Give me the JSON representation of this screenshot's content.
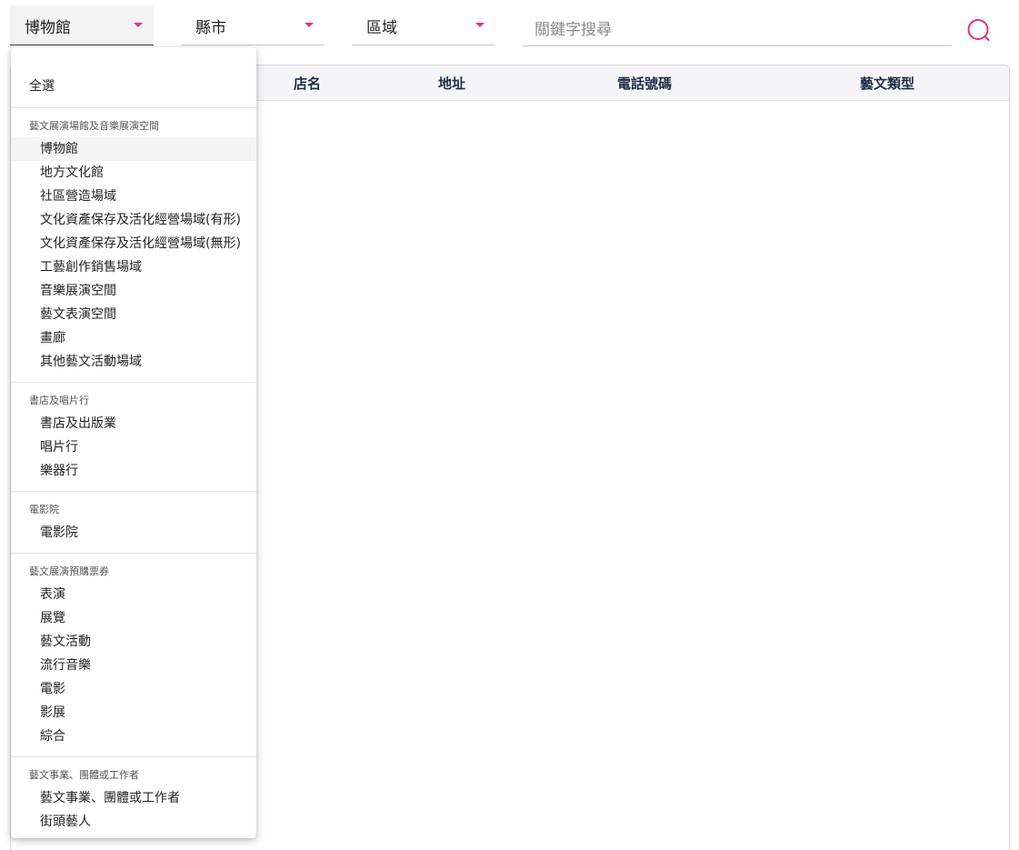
{
  "filters": {
    "category": {
      "value": "博物館"
    },
    "city": {
      "value": "縣市"
    },
    "area": {
      "value": "區域"
    },
    "keyword": {
      "placeholder": "關鍵字搜尋",
      "value": ""
    }
  },
  "colors": {
    "accent": "#e4327d",
    "header_text": "#1f2d4a"
  },
  "search_button": {
    "icon": "search-icon"
  },
  "table": {
    "columns": [
      "店名",
      "地址",
      "電話號碼",
      "藝文類型"
    ],
    "rows": []
  },
  "menu": {
    "all_label": "全選",
    "selected": "博物館",
    "groups": [
      {
        "title": "藝文展演場館及音樂展演空間",
        "items": [
          "博物館",
          "地方文化館",
          "社區營造場域",
          "文化資產保存及活化經營場域(有形)",
          "文化資產保存及活化經營場域(無形)",
          "工藝創作銷售場域",
          "音樂展演空間",
          "藝文表演空間",
          "畫廊",
          "其他藝文活動場域"
        ]
      },
      {
        "title": "書店及唱片行",
        "items": [
          "書店及出版業",
          "唱片行",
          "樂器行"
        ]
      },
      {
        "title": "電影院",
        "items": [
          "電影院"
        ]
      },
      {
        "title": "藝文展演預購票券",
        "items": [
          "表演",
          "展覽",
          "藝文活動",
          "流行音樂",
          "電影",
          "影展",
          "綜合"
        ]
      },
      {
        "title": "藝文事業、團體或工作者",
        "items": [
          "藝文事業、團體或工作者",
          "街頭藝人"
        ]
      }
    ]
  }
}
